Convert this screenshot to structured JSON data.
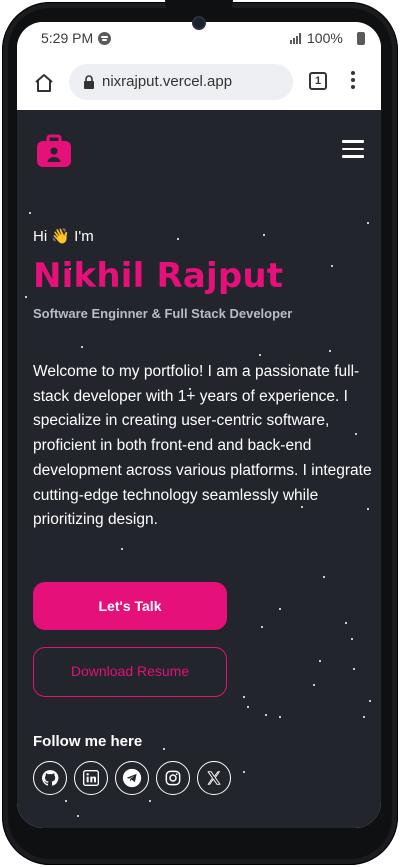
{
  "status_bar": {
    "time": "5:29 PM",
    "battery": "100%",
    "icons": [
      "spotify-icon",
      "signal-icon",
      "battery-icon"
    ]
  },
  "browser": {
    "url": "nixrajput.vercel.app",
    "tab_count": "1",
    "icons": [
      "home-icon",
      "lock-icon",
      "tabs-icon",
      "menu-dots-icon"
    ]
  },
  "header": {
    "icons": [
      "logo-icon",
      "hamburger-menu-icon"
    ]
  },
  "hero": {
    "greeting": "Hi 👋 I'm",
    "name": "Nikhil Rajput",
    "role": "Software Enginner & Full Stack Developer",
    "intro": "Welcome to my portfolio! I am a passionate full-stack developer with 1+ years of experience. I specialize in creating user-centric software, proficient in both front-end and back-end development across various platforms. I integrate cutting-edge technology seamlessly while prioritizing design."
  },
  "actions": {
    "talk_label": "Let's Talk",
    "resume_label": "Download Resume"
  },
  "social": {
    "heading": "Follow me here",
    "links": [
      "github-icon",
      "linkedin-icon",
      "telegram-icon",
      "instagram-icon",
      "x-icon"
    ]
  },
  "colors": {
    "accent": "#e5107a",
    "background": "#22252c",
    "text": "#ffffff",
    "muted": "#b9bcc3"
  }
}
